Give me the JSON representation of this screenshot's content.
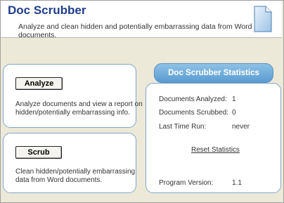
{
  "header": {
    "title": "Doc Scrubber",
    "subtitle": "Analyze and clean hidden and potentially embarrassing data from Word documents."
  },
  "analyze": {
    "button_label": "Analyze",
    "description_line1": "Analyze documents and view a report on",
    "description_line2": "hidden/potentially embarrassing info."
  },
  "scrub": {
    "button_label": "Scrub",
    "description_line1": "Clean hidden/potentially embarrassing",
    "description_line2": "data from Word documents."
  },
  "stats": {
    "title": "Doc Scrubber Statistics",
    "rows": [
      {
        "label": "Documents Analyzed:",
        "value": "1"
      },
      {
        "label": "Documents Scrubbed:",
        "value": "0"
      },
      {
        "label": "Last Time Run:",
        "value": "never"
      }
    ],
    "reset_label": "Reset Statistics",
    "version_label": "Program Version:",
    "version_value": "1.1"
  },
  "icons": {
    "header_icon": "document-icon"
  },
  "colors": {
    "title": "#1f3d8a",
    "panel_border": "#7fa6cf",
    "stats_header": "#5a9bd2",
    "background": "#ece9d8"
  }
}
